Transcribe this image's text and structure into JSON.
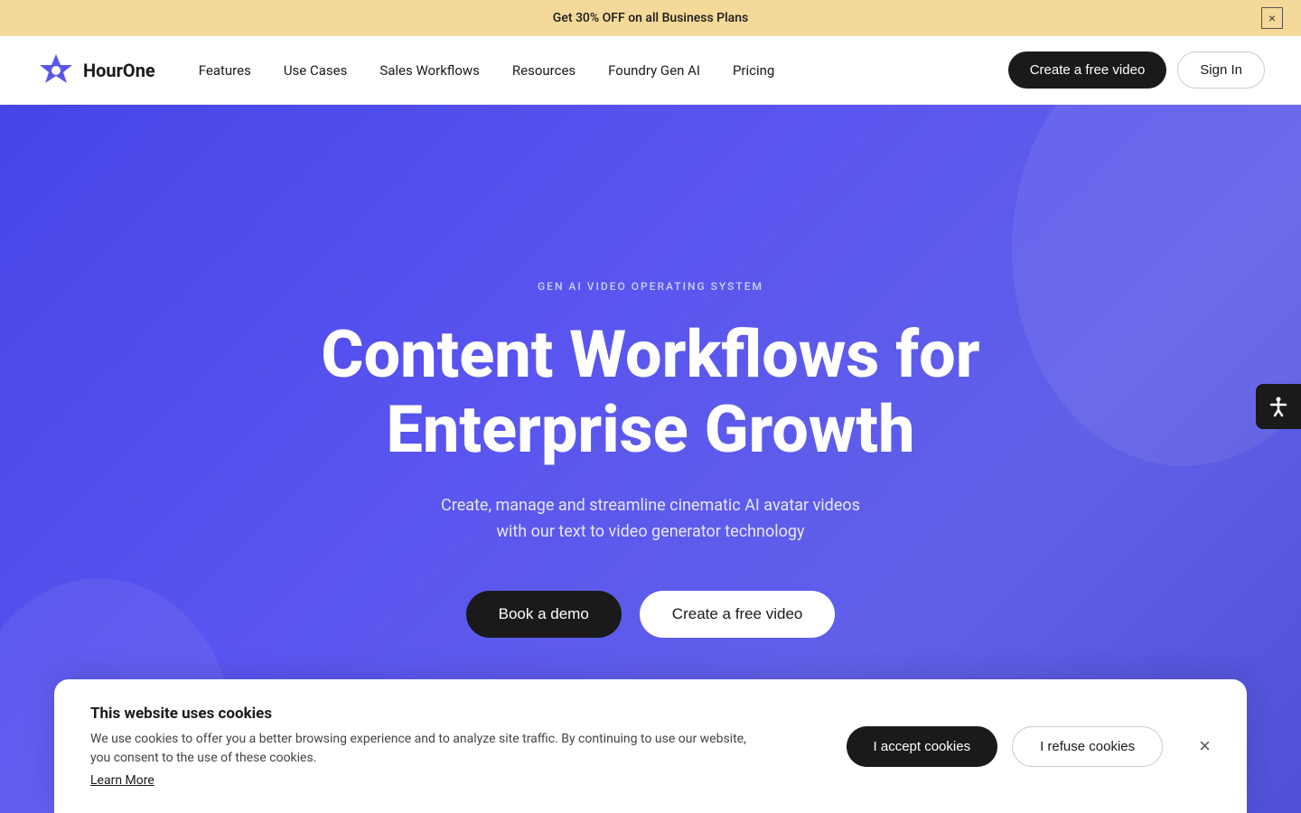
{
  "announcement": {
    "text": "Get 30% OFF on all Business Plans",
    "close_label": "×"
  },
  "navbar": {
    "logo_text_line1": "Hour",
    "logo_text_line2": "One",
    "links": [
      {
        "label": "Features"
      },
      {
        "label": "Use Cases"
      },
      {
        "label": "Sales Workflows"
      },
      {
        "label": "Resources"
      },
      {
        "label": "Foundry Gen AI"
      },
      {
        "label": "Pricing"
      }
    ],
    "cta_label": "Create a free video",
    "signin_label": "Sign In"
  },
  "hero": {
    "tag": "GEN AI VIDEO OPERATING SYSTEM",
    "title_line1": "Content Workflows for",
    "title_line2": "Enterprise Growth",
    "subtitle_line1": "Create, manage and streamline cinematic AI avatar videos",
    "subtitle_line2": "with our text to video generator technology",
    "btn_demo": "Book a demo",
    "btn_free": "Create a free video"
  },
  "accessibility": {
    "icon": "☿",
    "label": "Accessibility"
  },
  "cookie": {
    "title": "This website uses cookies",
    "text": "We use cookies to offer you a better browsing experience and to analyze site traffic. By continuing to use our website, you consent to the use of these cookies.",
    "learn_more": "Learn More",
    "accept": "I accept cookies",
    "refuse": "I refuse cookies",
    "close_label": "×"
  }
}
